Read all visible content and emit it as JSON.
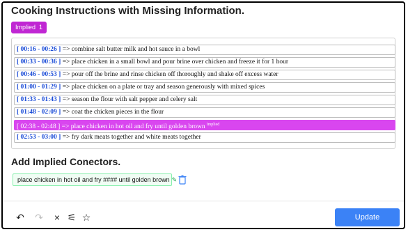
{
  "title": "Cooking Instructions with Missing Information.",
  "badge": {
    "label": "Implied",
    "count": "1",
    "color": "#c026d3"
  },
  "instructions": [
    {
      "time": "[ 00:16 - 00:26 ]",
      "text": " => combine salt butter milk and hot sauce in a bowl",
      "highlighted": false
    },
    {
      "time": "[ 00:33 - 00:36 ]",
      "text": " => place chicken in a small bowl and pour brine over chicken and freeze it for 1 hour",
      "highlighted": false
    },
    {
      "time": "[ 00:46 - 00:53 ]",
      "text": " => pour off the brine and rinse chicken off thoroughly and shake off excess water",
      "highlighted": false
    },
    {
      "time": "[ 01:00 - 01:29 ]",
      "text": " => place chicken on a plate or tray and season generously with mixed spices",
      "highlighted": false
    },
    {
      "time": "[ 01:33 - 01:43 ]",
      "text": " => season the flour with salt pepper and celery salt",
      "highlighted": false
    },
    {
      "time": "[ 01:48 - 02:09 ]",
      "text": " => coat the chicken pieces in the flour",
      "highlighted": false
    },
    {
      "time": "[ 02:38 - 02:48 ]",
      "text": " => place chicken in hot oil and fry until golden brown",
      "highlighted": true,
      "tag": "Implied"
    },
    {
      "time": "[ 02:53 - 03:00 ]",
      "text": " => fry dark meats together and white meats together",
      "highlighted": false
    }
  ],
  "connectors_title": "Add Implied Conectors.",
  "connector": {
    "text": "place chicken in hot oil and fry #### until golden brown"
  },
  "toolbar": {
    "undo_icon": "↶",
    "redo_icon": "↷",
    "clear_icon": "×",
    "settings_icon": "⚟",
    "star_icon": "☆",
    "update_label": "Update"
  },
  "colors": {
    "accent": "#3b82f6",
    "highlight": "#d946ef",
    "timestamp": "#1d4ed8"
  }
}
